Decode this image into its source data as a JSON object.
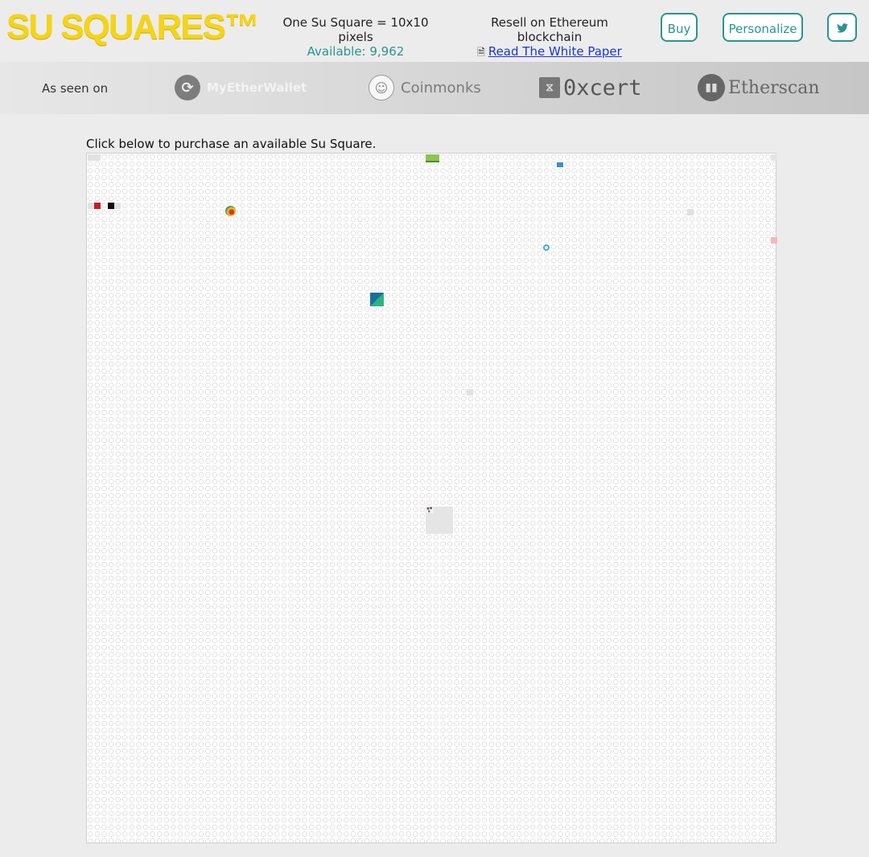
{
  "header": {
    "logo": "SU SQUARES™",
    "info_line1": "One Su Square = 10x10 pixels",
    "available": "Available: 9,962",
    "resell": "Resell on Ethereum blockchain",
    "white_paper": "Read The White Paper",
    "buttons": {
      "buy": "Buy",
      "personalize": "Personalize",
      "twitter": "🐦"
    }
  },
  "as_seen_on": {
    "label": "As seen on",
    "brands": [
      {
        "name": "MyEtherWallet",
        "icon": "myetherwallet-logo"
      },
      {
        "name": "Coinmonks",
        "icon": "coinmonks-logo"
      },
      {
        "name": "0xcert",
        "icon": "0xcert-logo"
      },
      {
        "name": "Etherscan",
        "icon": "etherscan-logo"
      }
    ]
  },
  "main": {
    "instruction": "Click below to purchase an available Su Square."
  },
  "colors": {
    "logo_yellow": "#f5d417",
    "teal": "#2a9490",
    "link_blue": "#1a35d6"
  }
}
